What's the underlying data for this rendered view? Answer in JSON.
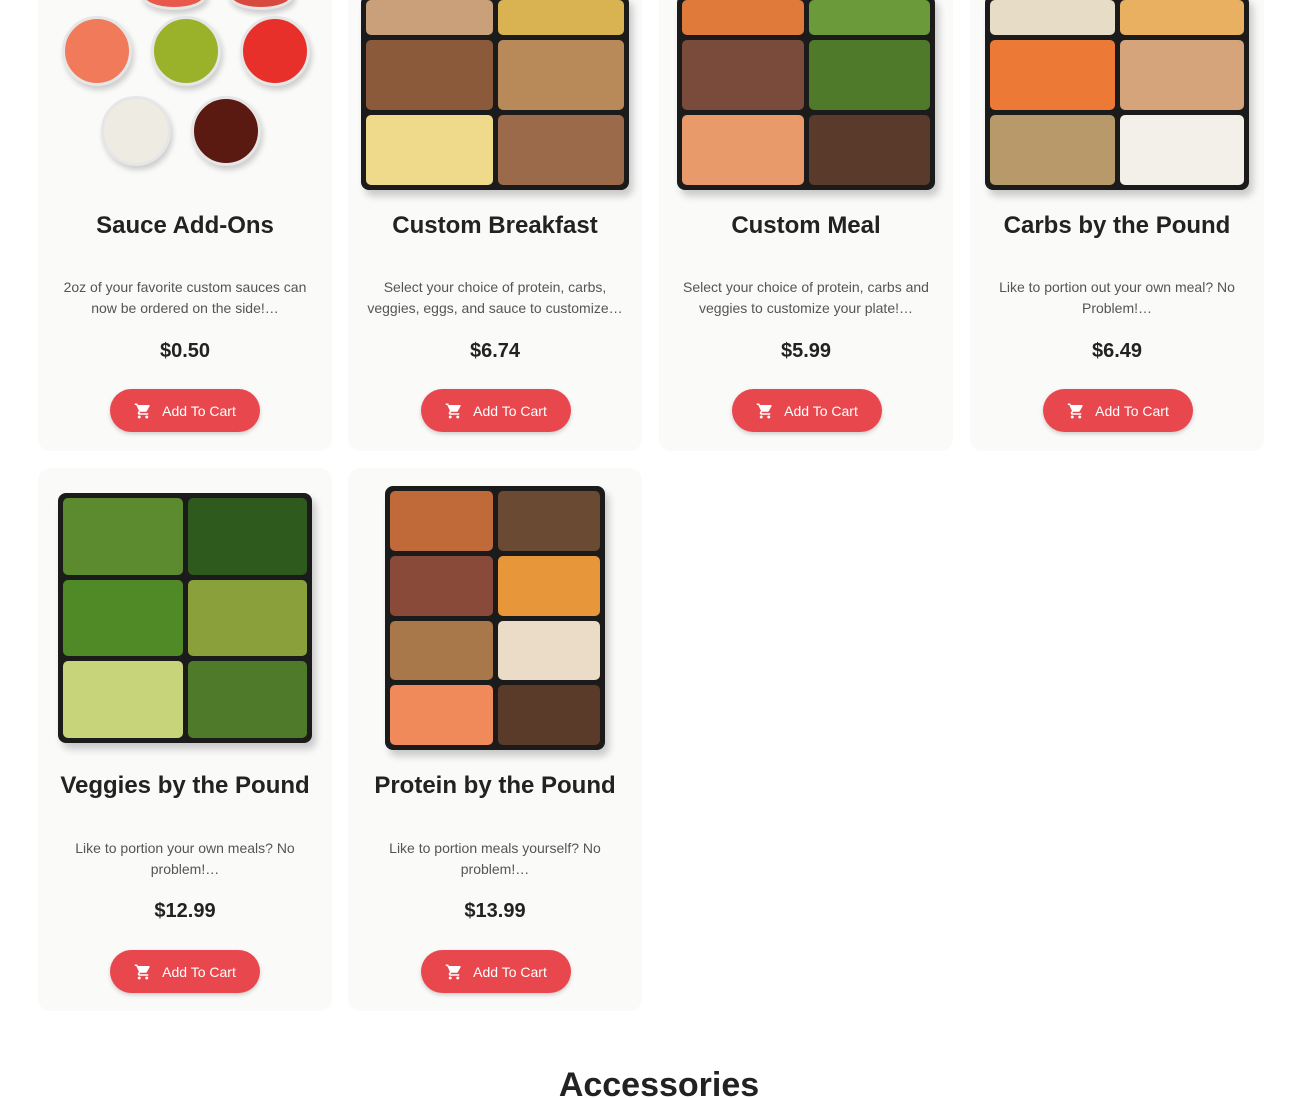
{
  "products": [
    {
      "title": "Sauce Add-Ons",
      "description": "2oz of your favorite custom sauces can now be ordered on the side!…",
      "price": "$0.50",
      "button": "Add To Cart",
      "image": "sauce-cups-image"
    },
    {
      "title": "Custom Breakfast",
      "description": "Select your choice of protein, carbs, veggies, eggs, and sauce to customize…",
      "price": "$6.74",
      "button": "Add To Cart",
      "image": "breakfast-trays-image"
    },
    {
      "title": "Custom Meal",
      "description": "Select your choice of protein, carbs and veggies to customize your plate!…",
      "price": "$5.99",
      "button": "Add To Cart",
      "image": "meal-trays-image"
    },
    {
      "title": "Carbs by the Pound",
      "description": "Like to portion out your own meal? No Problem!…",
      "price": "$6.49",
      "button": "Add To Cart",
      "image": "carb-trays-image"
    },
    {
      "title": "Veggies by the Pound",
      "description": "Like to portion your own meals? No problem!…",
      "price": "$12.99",
      "button": "Add To Cart",
      "image": "veggie-trays-image"
    },
    {
      "title": "Protein by the Pound",
      "description": "Like to portion meals yourself? No problem!…",
      "price": "$13.99",
      "button": "Add To Cart",
      "image": "protein-trays-image"
    }
  ],
  "section": {
    "title": "Accessories"
  },
  "icons": {
    "cart": "shopping-cart-icon"
  },
  "colors": {
    "accent": "#e8484d",
    "card_bg": "#fafaf9",
    "text": "#222222"
  }
}
